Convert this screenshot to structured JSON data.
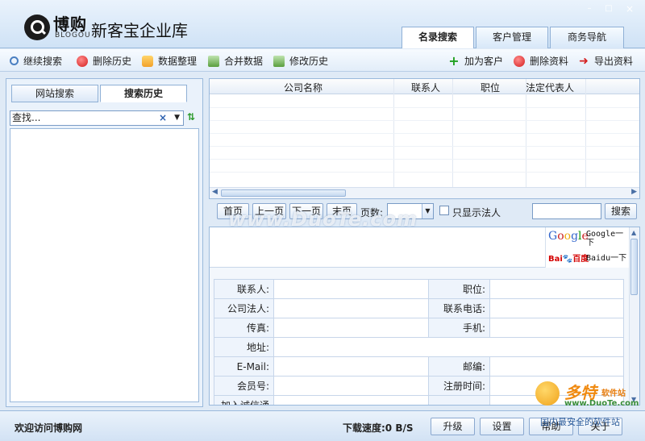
{
  "app": {
    "logo_cn": "博购",
    "logo_en": "BLOGOU",
    "title": "新客宝企业库"
  },
  "window_controls": {
    "minimize": "–",
    "maximize": "□",
    "close": "×"
  },
  "main_tabs": [
    {
      "label": "名录搜索",
      "active": true
    },
    {
      "label": "客户管理",
      "active": false
    },
    {
      "label": "商务导航",
      "active": false
    }
  ],
  "toolbar": {
    "left": [
      {
        "label": "继续搜索",
        "icon": "search-icon"
      },
      {
        "label": "删除历史",
        "icon": "delete-icon"
      },
      {
        "label": "数据整理",
        "icon": "folder-icon"
      },
      {
        "label": "合并数据",
        "icon": "database-icon"
      },
      {
        "label": "修改历史",
        "icon": "database-edit-icon"
      }
    ],
    "right": [
      {
        "label": "加为客户",
        "icon": "plus-icon"
      },
      {
        "label": "删除资料",
        "icon": "delete-icon"
      },
      {
        "label": "导出资料",
        "icon": "export-arrow-icon"
      }
    ]
  },
  "left_panel": {
    "tabs": [
      {
        "label": "网站搜索",
        "active": false
      },
      {
        "label": "搜索历史",
        "active": true
      }
    ],
    "search_value": "查找...",
    "clear_glyph": "×",
    "sort_glyph": "⇅"
  },
  "grid": {
    "columns": [
      "公司名称",
      "联系人",
      "职位",
      "法定代表人"
    ]
  },
  "pager": {
    "first": "首页",
    "prev": "上一页",
    "next": "下一页",
    "last": "末页",
    "pages_label": "页数:",
    "show_legal_label": "只显示法人",
    "search_button": "搜索"
  },
  "engines": {
    "google_label": "Google一下",
    "baidu_label": "Baidu一下",
    "baidu_logo_a": "Bai",
    "baidu_logo_b": "百度"
  },
  "detail_form": {
    "rows": [
      [
        "联系人:",
        "职位:"
      ],
      [
        "公司法人:",
        "联系电话:"
      ],
      [
        "传真:",
        "手机:"
      ],
      [
        "地址:",
        ""
      ],
      [
        "E-Mail:",
        "邮编:"
      ],
      [
        "会员号:",
        "注册时间:"
      ],
      [
        "加入诚信通",
        ""
      ]
    ]
  },
  "status": {
    "welcome": "欢迎访问博购网",
    "speed": "下载速度:0 B/S",
    "buttons": [
      "升级",
      "设置",
      "帮助",
      "关于"
    ]
  },
  "watermark": {
    "main": "www.DuoTe.com",
    "brand": "多特",
    "brand_sub": "软件站",
    "site": "www.DuoTe.com",
    "tagline": "国内最安全的软件站"
  }
}
